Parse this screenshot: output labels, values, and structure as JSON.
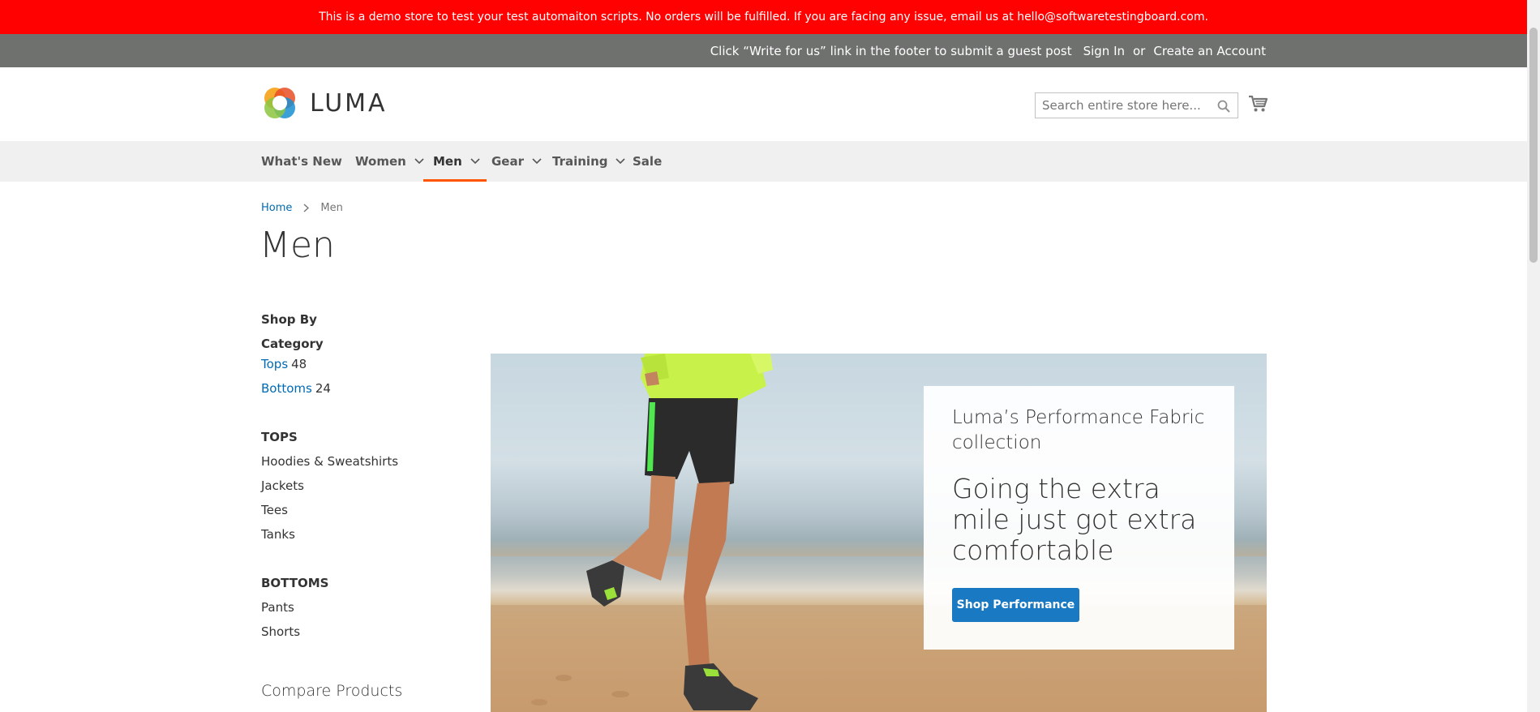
{
  "notice": {
    "text": "This is a demo store to test your test automaiton scripts. No orders will be fulfilled. If you are facing any issue, email us at hello@softwaretestingboard.com."
  },
  "panel": {
    "promo": "Click “Write for us” link in the footer to submit a guest post",
    "sign_in": "Sign In",
    "or": "or",
    "create_account": "Create an Account"
  },
  "header": {
    "logo_text": "LUMA",
    "search_placeholder": "Search entire store here...",
    "search_value": ""
  },
  "nav": {
    "items": [
      {
        "label": "What's New",
        "dropdown": false
      },
      {
        "label": "Women",
        "dropdown": true
      },
      {
        "label": "Men",
        "dropdown": true,
        "active": true
      },
      {
        "label": "Gear",
        "dropdown": true
      },
      {
        "label": "Training",
        "dropdown": true
      },
      {
        "label": "Sale",
        "dropdown": false
      }
    ]
  },
  "breadcrumb": {
    "home": "Home",
    "current": "Men"
  },
  "page_title": "Men",
  "sidebar": {
    "shop_by": "Shop By",
    "category_heading": "Category",
    "categories": [
      {
        "label": "Tops",
        "count": "48"
      },
      {
        "label": "Bottoms",
        "count": "24"
      }
    ],
    "tops_heading": "TOPS",
    "tops": [
      "Hoodies & Sweatshirts",
      "Jackets",
      "Tees",
      "Tanks"
    ],
    "bottoms_heading": "BOTTOMS",
    "bottoms": [
      "Pants",
      "Shorts"
    ],
    "compare": "Compare Products"
  },
  "hero": {
    "kicker": "Luma’s Performance Fabric collection",
    "headline": "Going the extra mile just got extra comfortable",
    "cta": "Shop Performance"
  },
  "colors": {
    "notice_bg": "#ff0101",
    "panel_bg": "#6e716e",
    "link": "#006bb4",
    "active_underline": "#ff5501",
    "cta_bg": "#1979c3"
  },
  "icons": {
    "logo": "luma-logo-icon",
    "search": "search-icon",
    "cart": "cart-icon",
    "nav_dropdown": "chevron-down-icon",
    "breadcrumb_sep": "chevron-right-icon"
  }
}
